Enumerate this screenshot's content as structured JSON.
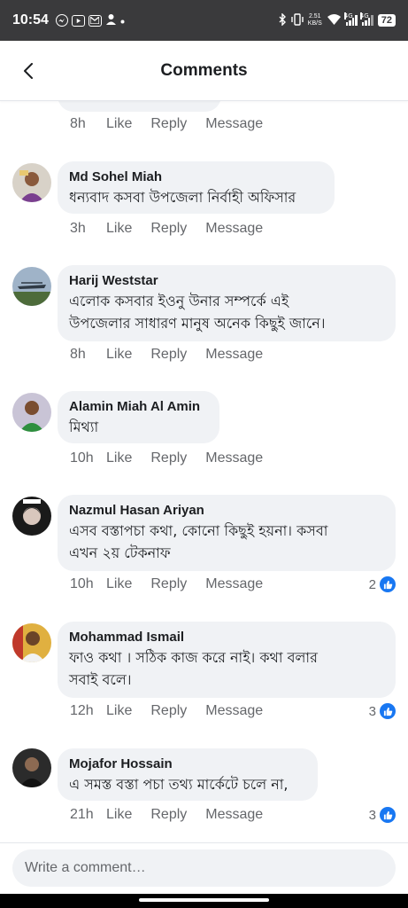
{
  "status_bar": {
    "time": "10:54",
    "network_speed_value": "2.51",
    "network_speed_unit": "KB/S",
    "signal_1": "4G",
    "signal_2": "4G",
    "battery": "72"
  },
  "header": {
    "title": "Comments"
  },
  "actions": {
    "like": "Like",
    "reply": "Reply",
    "message": "Message"
  },
  "partial_comment": {
    "time": "8h"
  },
  "comments": [
    {
      "author": "Md Sohel Miah",
      "lines": [
        "ধন্যবাদ কসবা উপজেলা নির্বাহী অফিসার"
      ],
      "time": "3h",
      "reactions": ""
    },
    {
      "author": "Harij Weststar",
      "lines": [
        "এলোক কসবার ইওনু উনার সম্পর্কে এই",
        "উপজেলার সাধারণ মানুষ অনেক কিছুই জানে।"
      ],
      "time": "8h",
      "reactions": ""
    },
    {
      "author": "Alamin Miah Al Amin",
      "lines": [
        "মিথ্যা"
      ],
      "time": "10h",
      "reactions": ""
    },
    {
      "author": "Nazmul Hasan Ariyan",
      "lines": [
        "এসব বস্তাপচা কথা, কোনো কিছুই হয়না। কসবা",
        "এখন ২য় টেকনাফ"
      ],
      "time": "10h",
      "reactions": "2"
    },
    {
      "author": "Mohammad Ismail",
      "lines": [
        "ফাও কথা ।  সঠিক কাজ করে নাই। কথা বলার",
        "সবাই বলে।"
      ],
      "time": "12h",
      "reactions": "3"
    },
    {
      "author": "Mojafor Hossain",
      "lines": [
        "এ সমস্ত বস্তা পচা তথ্য মার্কেটে চলে না,"
      ],
      "time": "21h",
      "reactions": "3"
    }
  ],
  "composer": {
    "placeholder": "Write a comment…"
  },
  "icons": {
    "back": "chevron-left-icon",
    "like": "thumbs-up-icon"
  },
  "colors": {
    "accent": "#1877f2",
    "bubble": "#f0f2f5",
    "muted": "#65676b"
  }
}
